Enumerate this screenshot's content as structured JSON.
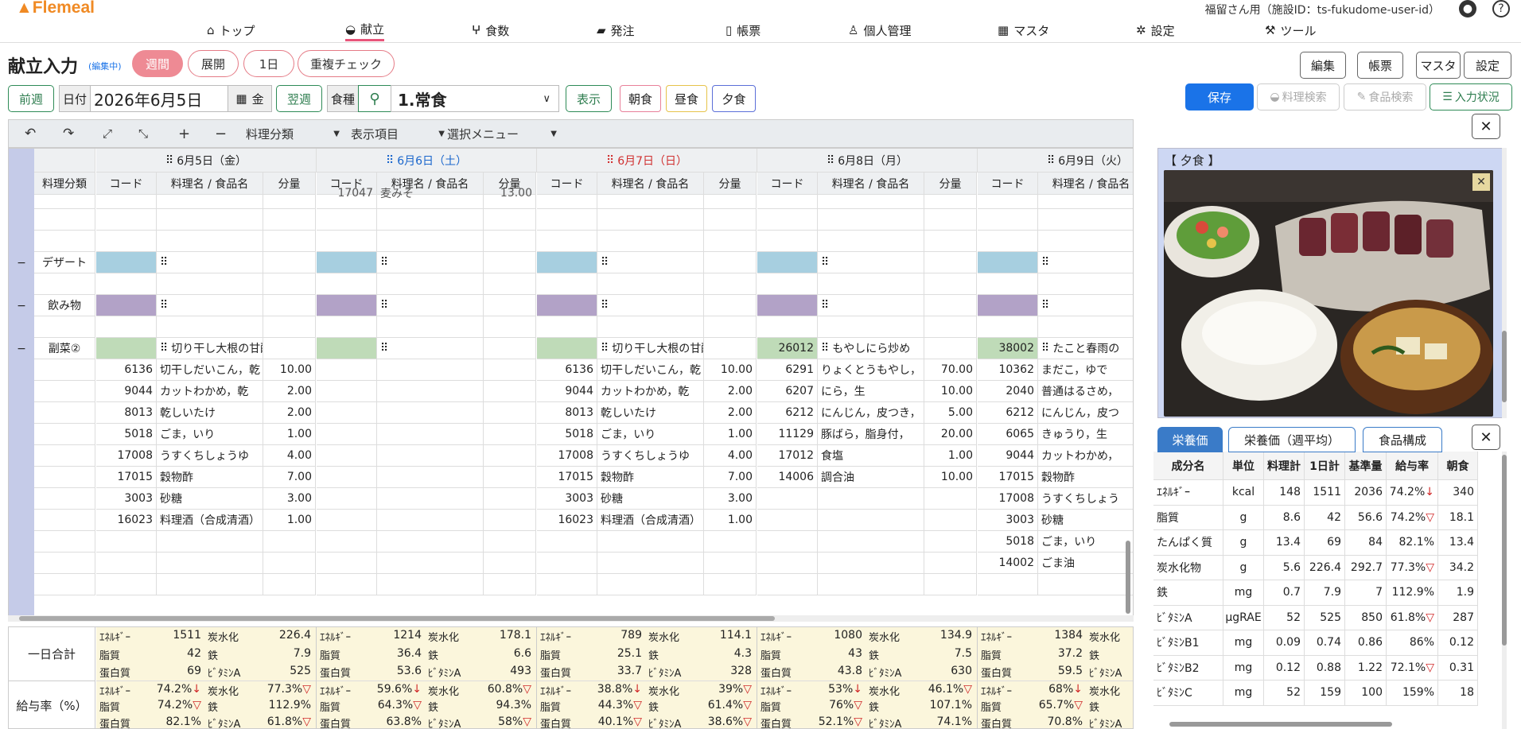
{
  "brand": "Flemeal",
  "nav": [
    {
      "label": "トップ",
      "icon": "home-icon"
    },
    {
      "label": "献立",
      "icon": "bowl-icon",
      "active": true
    },
    {
      "label": "食数",
      "icon": "utensils-icon"
    },
    {
      "label": "発注",
      "icon": "truck-icon"
    },
    {
      "label": "帳票",
      "icon": "file-icon"
    },
    {
      "label": "個人管理",
      "icon": "person-icon"
    },
    {
      "label": "マスタ",
      "icon": "table-icon"
    },
    {
      "label": "設定",
      "icon": "gears-icon"
    },
    {
      "label": "ツール",
      "icon": "wrench-icon"
    }
  ],
  "user": "福留さん用（施設ID：ts-fukudome-user-id）",
  "page_title": "献立入力",
  "editing_badge": "(編集中)",
  "view_tabs": [
    "週間",
    "展開",
    "1日",
    "重複チェック"
  ],
  "right_buttons": [
    "編集",
    "帳票",
    "マスタ",
    "設定"
  ],
  "filter": {
    "prev": "前週",
    "date_label": "日付",
    "date_value": "2026年6月5日",
    "day": "金",
    "next": "翌週",
    "meal_type_label": "食種",
    "meal_type_value": "1.常食",
    "show": "表示",
    "meals": [
      "朝食",
      "昼食",
      "夕食"
    ]
  },
  "actions": {
    "save": "保存",
    "recipe_search": "料理検索",
    "food_search": "食品検索",
    "input_status": "入力状況"
  },
  "toolbar": {
    "dish_class": "料理分類",
    "display_items": "表示項目",
    "select_menu": "選択メニュー"
  },
  "grid": {
    "class_header": "料理分類",
    "days": [
      {
        "label": "6月5日（金）",
        "color": "#222"
      },
      {
        "label": "6月6日（土）",
        "color": "#1a66cc"
      },
      {
        "label": "6月7日（日）",
        "color": "#d03030"
      },
      {
        "label": "6月8日（月）",
        "color": "#222"
      },
      {
        "label": "6月9日（火）",
        "color": "#222"
      }
    ],
    "col_code": "コード",
    "col_name": "料理名 / 食品名",
    "col_qty": "分量",
    "partial_row": {
      "code": "17047",
      "name": "麦みそ",
      "qty": "13.00"
    },
    "categories": [
      {
        "name": "デザート",
        "collapse": "−",
        "swatch": "#a7cfe0"
      },
      {
        "name": "飲み物",
        "collapse": "−",
        "swatch": "#b2a2c7"
      },
      {
        "name": "副菜②",
        "collapse": "−",
        "swatch": "#bfdbb8"
      }
    ],
    "dish_row": [
      {
        "code": "",
        "name": "切り干し大根の甘酢和え"
      },
      {
        "code": "",
        "name": ""
      },
      {
        "code": "",
        "name": "切り干し大根の甘酢和え"
      },
      {
        "code": "26012",
        "name": "もやしにら炒め"
      },
      {
        "code": "38002",
        "name": "たこと春雨の"
      }
    ],
    "items": [
      [
        {
          "c": "6136",
          "n": "切干しだいこん，乾",
          "q": "10.00"
        },
        {
          "c": "",
          "n": "",
          "q": ""
        },
        {
          "c": "6136",
          "n": "切干しだいこん，乾",
          "q": "10.00"
        },
        {
          "c": "6291",
          "n": "りょくとうもやし，",
          "q": "70.00"
        },
        {
          "c": "10362",
          "n": "まだこ，ゆで",
          "q": ""
        }
      ],
      [
        {
          "c": "9044",
          "n": "カットわかめ，乾",
          "q": "2.00"
        },
        {
          "c": "",
          "n": "",
          "q": ""
        },
        {
          "c": "9044",
          "n": "カットわかめ，乾",
          "q": "2.00"
        },
        {
          "c": "6207",
          "n": "にら，生",
          "q": "10.00"
        },
        {
          "c": "2040",
          "n": "普通はるさめ，",
          "q": ""
        }
      ],
      [
        {
          "c": "8013",
          "n": "乾しいたけ",
          "q": "2.00"
        },
        {
          "c": "",
          "n": "",
          "q": ""
        },
        {
          "c": "8013",
          "n": "乾しいたけ",
          "q": "2.00"
        },
        {
          "c": "6212",
          "n": "にんじん，皮つき，",
          "q": "5.00"
        },
        {
          "c": "6212",
          "n": "にんじん，皮つ",
          "q": ""
        }
      ],
      [
        {
          "c": "5018",
          "n": "ごま，いり",
          "q": "1.00"
        },
        {
          "c": "",
          "n": "",
          "q": ""
        },
        {
          "c": "5018",
          "n": "ごま，いり",
          "q": "1.00"
        },
        {
          "c": "11129",
          "n": "豚ばら，脂身付，",
          "q": "20.00"
        },
        {
          "c": "6065",
          "n": "きゅうり，生",
          "q": ""
        }
      ],
      [
        {
          "c": "17008",
          "n": "うすくちしょうゆ",
          "q": "4.00"
        },
        {
          "c": "",
          "n": "",
          "q": ""
        },
        {
          "c": "17008",
          "n": "うすくちしょうゆ",
          "q": "4.00"
        },
        {
          "c": "17012",
          "n": "食塩",
          "q": "1.00"
        },
        {
          "c": "9044",
          "n": "カットわかめ，",
          "q": ""
        }
      ],
      [
        {
          "c": "17015",
          "n": "穀物酢",
          "q": "7.00"
        },
        {
          "c": "",
          "n": "",
          "q": ""
        },
        {
          "c": "17015",
          "n": "穀物酢",
          "q": "7.00"
        },
        {
          "c": "14006",
          "n": "調合油",
          "q": "10.00"
        },
        {
          "c": "17015",
          "n": "穀物酢",
          "q": ""
        }
      ],
      [
        {
          "c": "3003",
          "n": "砂糖",
          "q": "3.00"
        },
        {
          "c": "",
          "n": "",
          "q": ""
        },
        {
          "c": "3003",
          "n": "砂糖",
          "q": "3.00"
        },
        {
          "c": "",
          "n": "",
          "q": ""
        },
        {
          "c": "17008",
          "n": "うすくちしょう",
          "q": ""
        }
      ],
      [
        {
          "c": "16023",
          "n": "料理酒（合成清酒）",
          "q": "1.00"
        },
        {
          "c": "",
          "n": "",
          "q": ""
        },
        {
          "c": "16023",
          "n": "料理酒（合成清酒）",
          "q": "1.00"
        },
        {
          "c": "",
          "n": "",
          "q": ""
        },
        {
          "c": "3003",
          "n": "砂糖",
          "q": ""
        }
      ],
      [
        {
          "c": "",
          "n": "",
          "q": ""
        },
        {
          "c": "",
          "n": "",
          "q": ""
        },
        {
          "c": "",
          "n": "",
          "q": ""
        },
        {
          "c": "",
          "n": "",
          "q": ""
        },
        {
          "c": "5018",
          "n": "ごま，いり",
          "q": ""
        }
      ],
      [
        {
          "c": "",
          "n": "",
          "q": ""
        },
        {
          "c": "",
          "n": "",
          "q": ""
        },
        {
          "c": "",
          "n": "",
          "q": ""
        },
        {
          "c": "",
          "n": "",
          "q": ""
        },
        {
          "c": "14002",
          "n": "ごま油",
          "q": ""
        }
      ]
    ]
  },
  "summary": {
    "daily_total_label": "一日合計",
    "ratio_label": "給与率（%）",
    "daily": [
      {
        "e": "1511",
        "f": "42",
        "p": "69",
        "c": "226.4",
        "fe": "7.9",
        "va": "525"
      },
      {
        "e": "1214",
        "f": "36.4",
        "p": "53.6",
        "c": "178.1",
        "fe": "6.6",
        "va": "493"
      },
      {
        "e": "789",
        "f": "25.1",
        "p": "33.7",
        "c": "114.1",
        "fe": "4.3",
        "va": "328"
      },
      {
        "e": "1080",
        "f": "43",
        "p": "43.8",
        "c": "134.9",
        "fe": "7.5",
        "va": "630"
      },
      {
        "e": "1384",
        "f": "37.2",
        "p": "59.5",
        "c": "",
        "fe": "",
        "va": ""
      }
    ],
    "ratio": [
      {
        "e": "74.2%↓",
        "f": "74.2%▽",
        "p": "82.1%",
        "c": "77.3%▽",
        "fe": "112.9%",
        "va": "61.8%▽"
      },
      {
        "e": "59.6%↓",
        "f": "64.3%▽",
        "p": "63.8%",
        "c": "60.8%▽",
        "fe": "94.3%",
        "va": "58%▽"
      },
      {
        "e": "38.8%↓",
        "f": "44.3%▽",
        "p": "40.1%▽",
        "c": "39%▽",
        "fe": "61.4%▽",
        "va": "38.6%▽"
      },
      {
        "e": "53%↓",
        "f": "76%▽",
        "p": "52.1%▽",
        "c": "46.1%▽",
        "fe": "107.1%",
        "va": "74.1%"
      },
      {
        "e": "68%↓",
        "f": "65.7%▽",
        "p": "70.8%",
        "c": "",
        "fe": "",
        "va": ""
      }
    ],
    "labels": {
      "e": "ｴﾈﾙｷﾞｰ",
      "f": "脂質",
      "p": "蛋白質",
      "c": "炭水化",
      "fe": "鉄",
      "va": "ﾋﾞﾀﾐﾝA"
    }
  },
  "image_panel": {
    "title": "【 夕食 】"
  },
  "nutrition_tabs": [
    "栄養価",
    "栄養価（週平均）",
    "食品構成"
  ],
  "nutrition_table": {
    "headers": [
      "成分名",
      "単位",
      "料理計",
      "1日計",
      "基準量",
      "給与率",
      "朝食"
    ],
    "rows": [
      [
        "ｴﾈﾙｷﾞｰ",
        "kcal",
        "148",
        "1511",
        "2036",
        "74.2%↓",
        "340"
      ],
      [
        "脂質",
        "g",
        "8.6",
        "42",
        "56.6",
        "74.2%▽",
        "18.1"
      ],
      [
        "たんぱく質",
        "g",
        "13.4",
        "69",
        "84",
        "82.1%",
        "13.4"
      ],
      [
        "炭水化物",
        "g",
        "5.6",
        "226.4",
        "292.7",
        "77.3%▽",
        "34.2"
      ],
      [
        "鉄",
        "mg",
        "0.7",
        "7.9",
        "7",
        "112.9%",
        "1.9"
      ],
      [
        "ﾋﾞﾀﾐﾝA",
        "μgRAE",
        "52",
        "525",
        "850",
        "61.8%▽",
        "287"
      ],
      [
        "ﾋﾞﾀﾐﾝB1",
        "mg",
        "0.09",
        "0.74",
        "0.86",
        "86%",
        "0.12"
      ],
      [
        "ﾋﾞﾀﾐﾝB2",
        "mg",
        "0.12",
        "0.88",
        "1.22",
        "72.1%▽",
        "0.31"
      ],
      [
        "ﾋﾞﾀﾐﾝC",
        "mg",
        "52",
        "159",
        "100",
        "159%",
        "18"
      ]
    ]
  },
  "colors": {
    "accent": "#ee8a94",
    "green": "#2e7d4f",
    "blue": "#1a73e8",
    "tab_blue": "#3a7bc8"
  }
}
